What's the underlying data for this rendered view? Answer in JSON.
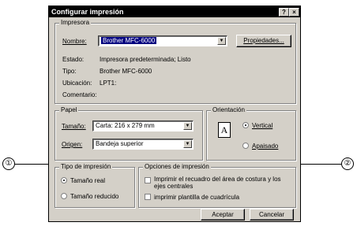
{
  "dialog": {
    "title": "Configurar impresión",
    "help_button": "?",
    "close_button": "×"
  },
  "printer": {
    "group_label": "Impresora",
    "name_label": "Nombre:",
    "name_value": "Brother MFC-6000",
    "properties_button": "Propiedades...",
    "status_label": "Estado:",
    "status_value": "Impresora predeterminada; Listo",
    "type_label": "Tipo:",
    "type_value": "Brother MFC-6000",
    "location_label": "Ubicación:",
    "location_value": "LPT1:",
    "comment_label": "Comentario:"
  },
  "paper": {
    "group_label": "Papel",
    "size_label": "Tamaño:",
    "size_value": "Carta: 216 x 279 mm",
    "source_label": "Origen:",
    "source_value": "Bandeja superior"
  },
  "orientation": {
    "group_label": "Orientación",
    "icon_letter": "A",
    "vertical_label": "Vertical",
    "horizontal_label": "Apaisado",
    "selected": "Vertical"
  },
  "print_type": {
    "group_label": "Tipo de impresión",
    "real_size_label": "Tamaño real",
    "reduced_size_label": "Tamaño reducido",
    "selected": "Tamaño real"
  },
  "print_options": {
    "group_label": "Opciones de impresión",
    "option1_line1": "Imprimir el recuadro del área de costura y los",
    "option1_line2": "ejes centrales",
    "option2_label": "imprimir plantilla de cuadrícula"
  },
  "buttons": {
    "accept": "Aceptar",
    "cancel": "Cancelar"
  },
  "callouts": {
    "left": "①",
    "right": "②"
  }
}
